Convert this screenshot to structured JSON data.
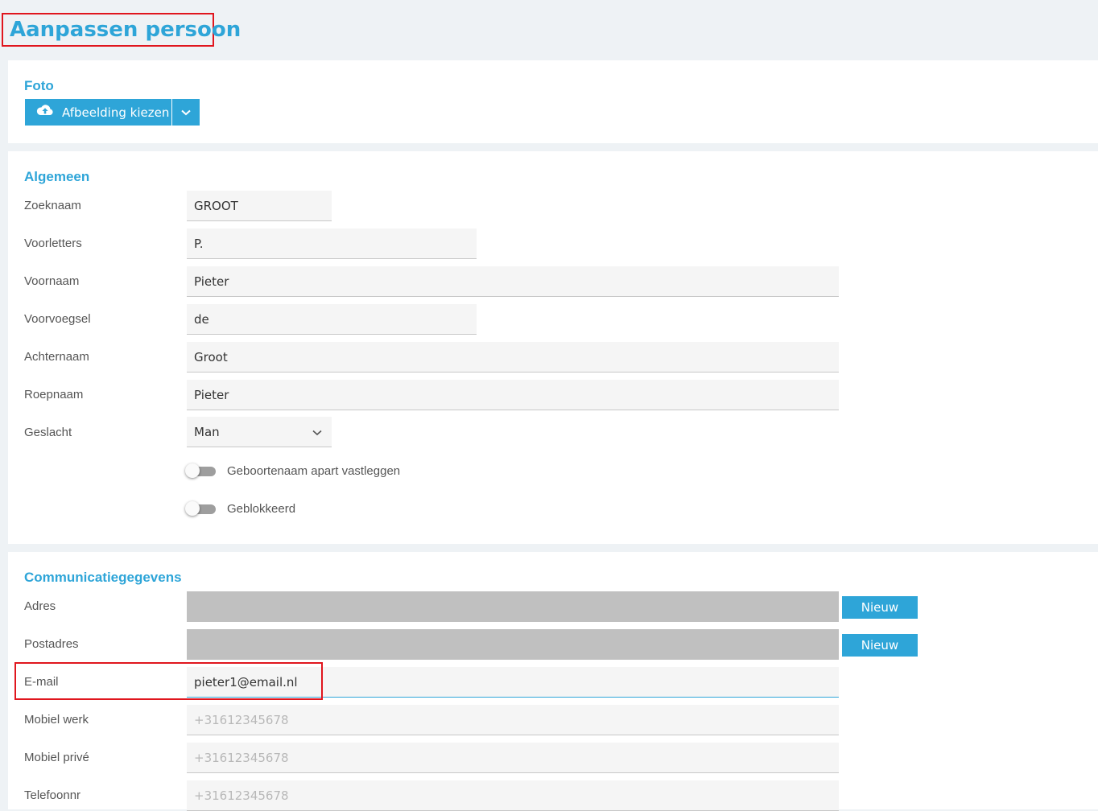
{
  "page": {
    "title": "Aanpassen persoon"
  },
  "foto": {
    "title": "Foto",
    "upload_button": "Afbeelding kiezen",
    "upload_icon": "cloud-upload-icon",
    "dropdown_icon": "chevron-down-icon"
  },
  "algemeen": {
    "title": "Algemeen",
    "fields": {
      "zoeknaam": {
        "label": "Zoeknaam",
        "value": "GROOT"
      },
      "voorletters": {
        "label": "Voorletters",
        "value": "P."
      },
      "voornaam": {
        "label": "Voornaam",
        "value": "Pieter"
      },
      "voorvoegsel": {
        "label": "Voorvoegsel",
        "value": "de"
      },
      "achternaam": {
        "label": "Achternaam",
        "value": "Groot"
      },
      "roepnaam": {
        "label": "Roepnaam",
        "value": "Pieter"
      },
      "geslacht": {
        "label": "Geslacht",
        "value": "Man"
      }
    },
    "toggles": {
      "geboortenaam": {
        "label": "Geboortenaam apart vastleggen",
        "checked": false
      },
      "geblokkeerd": {
        "label": "Geblokkeerd",
        "checked": false
      }
    }
  },
  "communicatie": {
    "title": "Communicatiegegevens",
    "fields": {
      "adres": {
        "label": "Adres",
        "value": "",
        "button": "Nieuw"
      },
      "postadres": {
        "label": "Postadres",
        "value": "",
        "button": "Nieuw"
      },
      "email": {
        "label": "E-mail",
        "value": "pieter1@email.nl"
      },
      "mobiel_werk": {
        "label": "Mobiel werk",
        "value": "",
        "placeholder": "+31612345678"
      },
      "mobiel_prive": {
        "label": "Mobiel privé",
        "value": "",
        "placeholder": "+31612345678"
      },
      "telefoonnr": {
        "label": "Telefoonnr",
        "value": "",
        "placeholder": "+31612345678"
      }
    }
  },
  "colors": {
    "accent": "#2ea5d8",
    "highlight": "#e0161e",
    "page_background": "#eef2f5",
    "input_background": "#f5f5f5",
    "readonly_background": "#c0c0c0"
  }
}
